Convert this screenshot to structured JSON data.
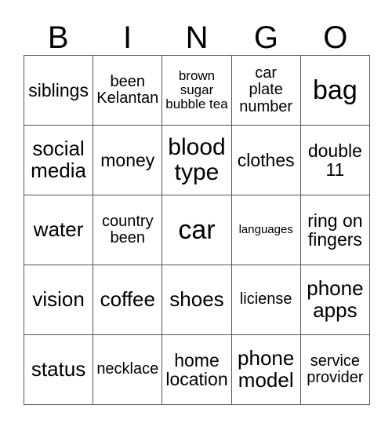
{
  "card": {
    "header_letters": [
      "B",
      "I",
      "N",
      "G",
      "O"
    ],
    "rows": [
      [
        {
          "text": "siblings",
          "size": "md"
        },
        {
          "text": "been\nKelantan",
          "size": "sm"
        },
        {
          "text": "brown\nsugar\nbubble tea",
          "size": "xs"
        },
        {
          "text": "car\nplate\nnumber",
          "size": "sm"
        },
        {
          "text": "bag",
          "size": "xxl"
        }
      ],
      [
        {
          "text": "social\nmedia",
          "size": "lg"
        },
        {
          "text": "money",
          "size": "md"
        },
        {
          "text": "blood\ntype",
          "size": "xl"
        },
        {
          "text": "clothes",
          "size": "md"
        },
        {
          "text": "double\n11",
          "size": "md"
        }
      ],
      [
        {
          "text": "water",
          "size": "lg"
        },
        {
          "text": "country\nbeen",
          "size": "sm"
        },
        {
          "text": "car",
          "size": "xxl"
        },
        {
          "text": "languages",
          "size": "xxs"
        },
        {
          "text": "ring on\nfingers",
          "size": "md"
        }
      ],
      [
        {
          "text": "vision",
          "size": "lg"
        },
        {
          "text": "coffee",
          "size": "lg"
        },
        {
          "text": "shoes",
          "size": "lg"
        },
        {
          "text": "liciense",
          "size": "sm"
        },
        {
          "text": "phone\napps",
          "size": "lg"
        }
      ],
      [
        {
          "text": "status",
          "size": "lg"
        },
        {
          "text": "necklace",
          "size": "sm"
        },
        {
          "text": "home\nlocation",
          "size": "md"
        },
        {
          "text": "phone\nmodel",
          "size": "lg"
        },
        {
          "text": "service\nprovider",
          "size": "sm"
        }
      ]
    ],
    "colors": {
      "background": "#ffffff",
      "text": "#000000",
      "grid_line": "#555555"
    }
  }
}
